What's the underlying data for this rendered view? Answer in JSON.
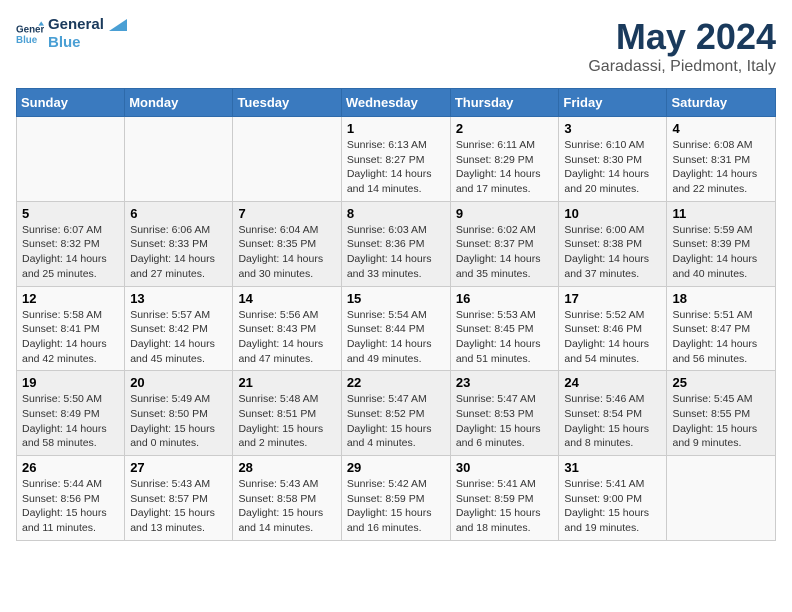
{
  "logo": {
    "line1": "General",
    "line2": "Blue"
  },
  "title": "May 2024",
  "subtitle": "Garadassi, Piedmont, Italy",
  "days_of_week": [
    "Sunday",
    "Monday",
    "Tuesday",
    "Wednesday",
    "Thursday",
    "Friday",
    "Saturday"
  ],
  "weeks": [
    [
      {
        "num": "",
        "info": ""
      },
      {
        "num": "",
        "info": ""
      },
      {
        "num": "",
        "info": ""
      },
      {
        "num": "1",
        "info": "Sunrise: 6:13 AM\nSunset: 8:27 PM\nDaylight: 14 hours\nand 14 minutes."
      },
      {
        "num": "2",
        "info": "Sunrise: 6:11 AM\nSunset: 8:29 PM\nDaylight: 14 hours\nand 17 minutes."
      },
      {
        "num": "3",
        "info": "Sunrise: 6:10 AM\nSunset: 8:30 PM\nDaylight: 14 hours\nand 20 minutes."
      },
      {
        "num": "4",
        "info": "Sunrise: 6:08 AM\nSunset: 8:31 PM\nDaylight: 14 hours\nand 22 minutes."
      }
    ],
    [
      {
        "num": "5",
        "info": "Sunrise: 6:07 AM\nSunset: 8:32 PM\nDaylight: 14 hours\nand 25 minutes."
      },
      {
        "num": "6",
        "info": "Sunrise: 6:06 AM\nSunset: 8:33 PM\nDaylight: 14 hours\nand 27 minutes."
      },
      {
        "num": "7",
        "info": "Sunrise: 6:04 AM\nSunset: 8:35 PM\nDaylight: 14 hours\nand 30 minutes."
      },
      {
        "num": "8",
        "info": "Sunrise: 6:03 AM\nSunset: 8:36 PM\nDaylight: 14 hours\nand 33 minutes."
      },
      {
        "num": "9",
        "info": "Sunrise: 6:02 AM\nSunset: 8:37 PM\nDaylight: 14 hours\nand 35 minutes."
      },
      {
        "num": "10",
        "info": "Sunrise: 6:00 AM\nSunset: 8:38 PM\nDaylight: 14 hours\nand 37 minutes."
      },
      {
        "num": "11",
        "info": "Sunrise: 5:59 AM\nSunset: 8:39 PM\nDaylight: 14 hours\nand 40 minutes."
      }
    ],
    [
      {
        "num": "12",
        "info": "Sunrise: 5:58 AM\nSunset: 8:41 PM\nDaylight: 14 hours\nand 42 minutes."
      },
      {
        "num": "13",
        "info": "Sunrise: 5:57 AM\nSunset: 8:42 PM\nDaylight: 14 hours\nand 45 minutes."
      },
      {
        "num": "14",
        "info": "Sunrise: 5:56 AM\nSunset: 8:43 PM\nDaylight: 14 hours\nand 47 minutes."
      },
      {
        "num": "15",
        "info": "Sunrise: 5:54 AM\nSunset: 8:44 PM\nDaylight: 14 hours\nand 49 minutes."
      },
      {
        "num": "16",
        "info": "Sunrise: 5:53 AM\nSunset: 8:45 PM\nDaylight: 14 hours\nand 51 minutes."
      },
      {
        "num": "17",
        "info": "Sunrise: 5:52 AM\nSunset: 8:46 PM\nDaylight: 14 hours\nand 54 minutes."
      },
      {
        "num": "18",
        "info": "Sunrise: 5:51 AM\nSunset: 8:47 PM\nDaylight: 14 hours\nand 56 minutes."
      }
    ],
    [
      {
        "num": "19",
        "info": "Sunrise: 5:50 AM\nSunset: 8:49 PM\nDaylight: 14 hours\nand 58 minutes."
      },
      {
        "num": "20",
        "info": "Sunrise: 5:49 AM\nSunset: 8:50 PM\nDaylight: 15 hours\nand 0 minutes."
      },
      {
        "num": "21",
        "info": "Sunrise: 5:48 AM\nSunset: 8:51 PM\nDaylight: 15 hours\nand 2 minutes."
      },
      {
        "num": "22",
        "info": "Sunrise: 5:47 AM\nSunset: 8:52 PM\nDaylight: 15 hours\nand 4 minutes."
      },
      {
        "num": "23",
        "info": "Sunrise: 5:47 AM\nSunset: 8:53 PM\nDaylight: 15 hours\nand 6 minutes."
      },
      {
        "num": "24",
        "info": "Sunrise: 5:46 AM\nSunset: 8:54 PM\nDaylight: 15 hours\nand 8 minutes."
      },
      {
        "num": "25",
        "info": "Sunrise: 5:45 AM\nSunset: 8:55 PM\nDaylight: 15 hours\nand 9 minutes."
      }
    ],
    [
      {
        "num": "26",
        "info": "Sunrise: 5:44 AM\nSunset: 8:56 PM\nDaylight: 15 hours\nand 11 minutes."
      },
      {
        "num": "27",
        "info": "Sunrise: 5:43 AM\nSunset: 8:57 PM\nDaylight: 15 hours\nand 13 minutes."
      },
      {
        "num": "28",
        "info": "Sunrise: 5:43 AM\nSunset: 8:58 PM\nDaylight: 15 hours\nand 14 minutes."
      },
      {
        "num": "29",
        "info": "Sunrise: 5:42 AM\nSunset: 8:59 PM\nDaylight: 15 hours\nand 16 minutes."
      },
      {
        "num": "30",
        "info": "Sunrise: 5:41 AM\nSunset: 8:59 PM\nDaylight: 15 hours\nand 18 minutes."
      },
      {
        "num": "31",
        "info": "Sunrise: 5:41 AM\nSunset: 9:00 PM\nDaylight: 15 hours\nand 19 minutes."
      },
      {
        "num": "",
        "info": ""
      }
    ]
  ]
}
